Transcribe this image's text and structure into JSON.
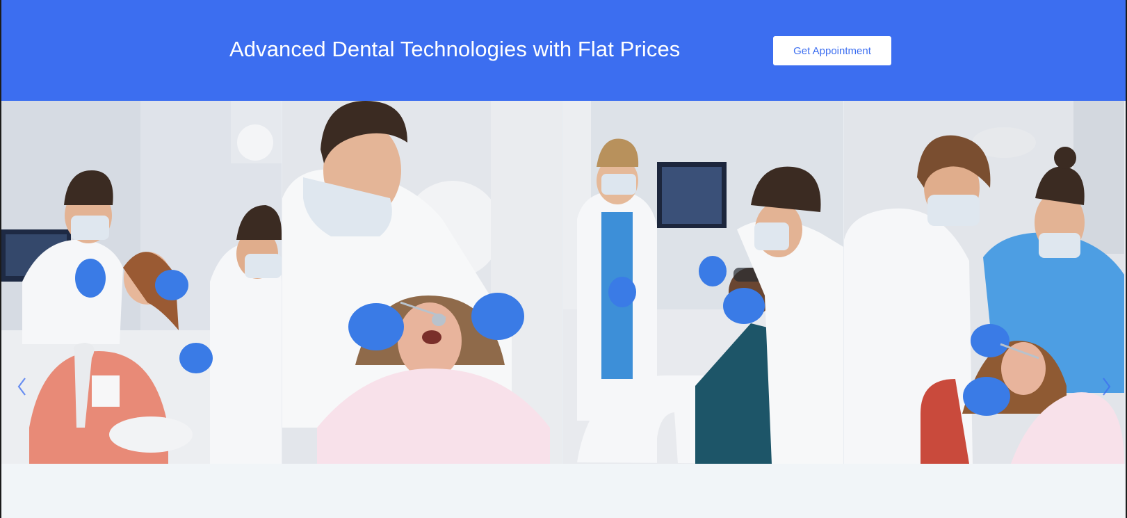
{
  "cta": {
    "title": "Advanced Dental Technologies with Flat Prices",
    "button_label": "Get Appointment"
  },
  "colors": {
    "brand_blue": "#3c6ef0",
    "page_background": "#f1f5f8",
    "glove_blue": "#3a7be6"
  },
  "gallery": {
    "slides": [
      {
        "subject": "dentist-examining-patient"
      },
      {
        "subject": "dentist-closeup-with-mirror"
      },
      {
        "subject": "dentist-and-assistant-with-patient"
      },
      {
        "subject": "dentist-and-assistant-treating-child"
      }
    ],
    "prev_icon": "chevron-left-icon",
    "next_icon": "chevron-right-icon"
  }
}
